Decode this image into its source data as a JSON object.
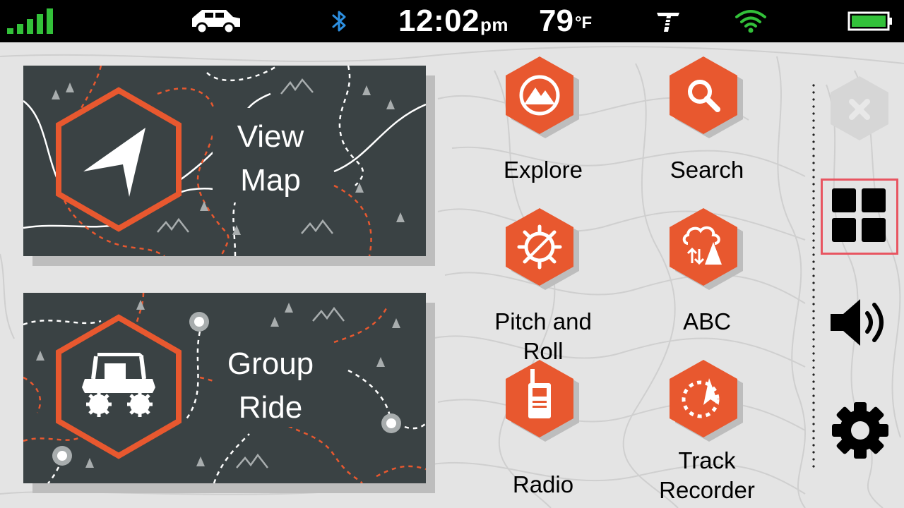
{
  "status_bar": {
    "signal_icon": "signal-bars-icon",
    "vehicle_icon": "suv-icon",
    "bluetooth_icon": "bluetooth-icon",
    "time": "12:02",
    "time_suffix": "pm",
    "temperature": "79",
    "temperature_unit": "°F",
    "logo_icon": "brand-logo-icon",
    "wifi_icon": "wifi-icon",
    "battery_icon": "battery-icon",
    "colors": {
      "signal": "#33c13a",
      "bluetooth": "#2d8fe0",
      "wifi": "#33c13a",
      "battery": "#33c13a"
    }
  },
  "cards": {
    "view_map": {
      "label": "View\nMap",
      "icon": "navigation-arrow-icon"
    },
    "group_ride": {
      "label": "Group\nRide",
      "icon": "side-by-side-vehicle-icon"
    }
  },
  "tiles": {
    "explore": {
      "label": "Explore",
      "icon": "mountain-icon"
    },
    "search": {
      "label": "Search",
      "icon": "magnifier-icon"
    },
    "pitch_roll": {
      "label": "Pitch and Roll",
      "icon": "gear-slash-icon"
    },
    "abc": {
      "label": "ABC",
      "icon": "cloud-arrows-icon"
    },
    "radio": {
      "label": "Radio",
      "icon": "walkie-talkie-icon"
    },
    "track_recorder": {
      "label": "Track\nRecorder",
      "icon": "track-arrow-icon"
    }
  },
  "rail": {
    "close_icon": "close-icon",
    "apps_icon": "apps-grid-icon",
    "volume_icon": "volume-icon",
    "settings_icon": "settings-gear-icon"
  },
  "colors": {
    "accent": "#e8582f",
    "card": "#3a4244",
    "background": "#e4e4e4"
  }
}
